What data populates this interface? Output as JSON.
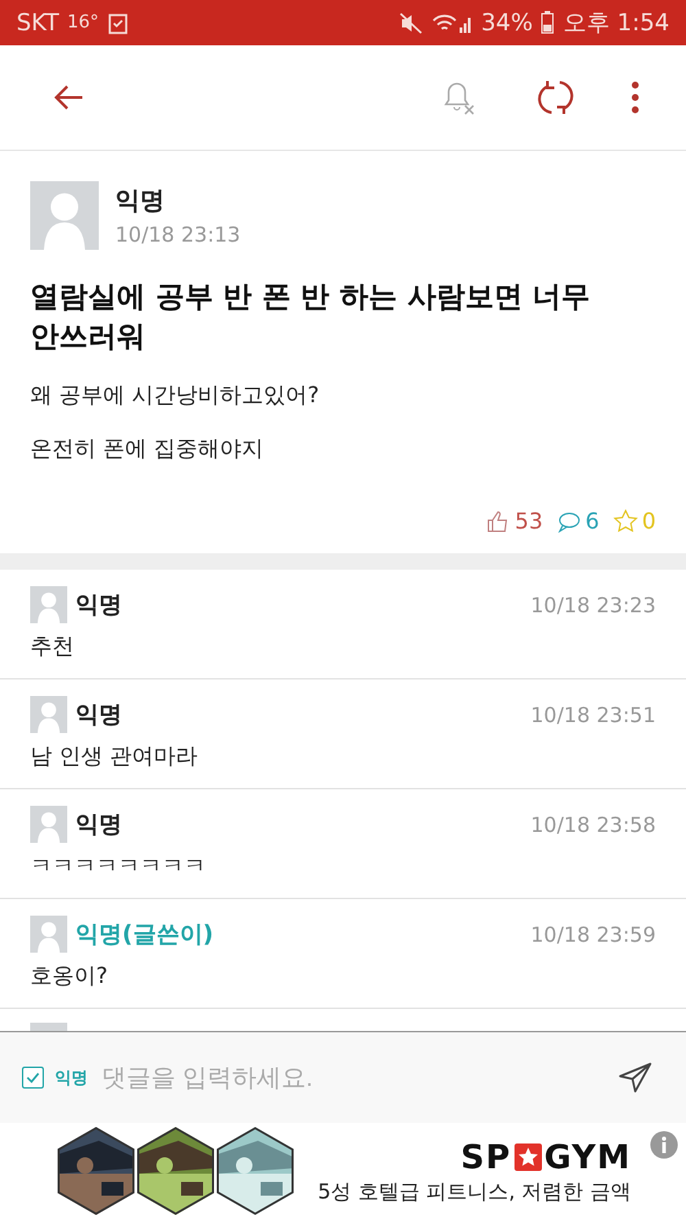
{
  "status_bar": {
    "carrier": "SKT",
    "temperature": "16°",
    "battery": "34%",
    "time": "오후 1:54"
  },
  "toolbar": {
    "notifications_muted": true
  },
  "post": {
    "author": "익명",
    "time": "10/18 23:13",
    "title": "열람실에 공부 반 폰 반 하는 사람보면 너무 안쓰러워",
    "paragraphs": [
      "왜 공부에 시간낭비하고있어?",
      "온전히 폰에 집중해야지"
    ],
    "likes": "53",
    "comments": "6",
    "scraps": "0"
  },
  "comments": [
    {
      "author": "익명",
      "is_writer": false,
      "time": "10/18 23:23",
      "text": "추천"
    },
    {
      "author": "익명",
      "is_writer": false,
      "time": "10/18 23:51",
      "text": "남 인생 관여마라"
    },
    {
      "author": "익명",
      "is_writer": false,
      "time": "10/18 23:58",
      "text": "ㅋㅋㅋㅋㅋㅋㅋㅋ"
    },
    {
      "author": "익명(글쓴이)",
      "is_writer": true,
      "time": "10/18 23:59",
      "text": "호옹이?"
    }
  ],
  "comment_input": {
    "anonymous_label": "익명",
    "anonymous_checked": true,
    "placeholder": "댓글을 입력하세요."
  },
  "ad": {
    "brand_left": "SP",
    "brand_right": "GYM",
    "tagline": "5성 호텔급 피트니스, 저렴한 금액"
  }
}
